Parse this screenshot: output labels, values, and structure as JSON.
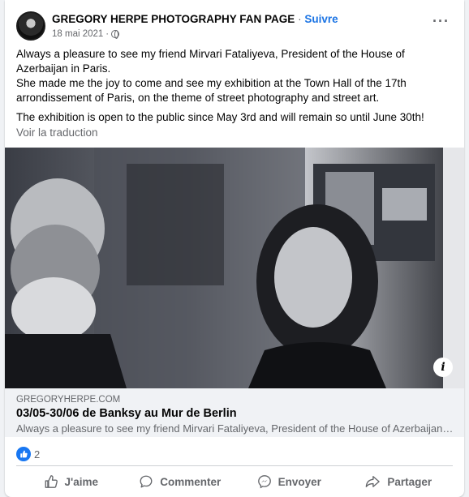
{
  "header": {
    "page_name": "GREGORY HERPE PHOTOGRAPHY FAN PAGE",
    "separator": " · ",
    "follow_label": "Suivre",
    "date": "18 mai 2021",
    "meta_separator": "·",
    "audience_icon": "globe-icon",
    "more_label": "···"
  },
  "post": {
    "paragraphs": [
      "Always a pleasure to see my friend Mirvari Fataliyeva, President of the House of Azerbaijan in Paris.\nShe made me the joy to come and see my exhibition at the Town Hall of the 17th arrondissement of Paris, on the theme of street photography and street art.",
      "The exhibition is open to the public since May 3rd and will remain so until June 30th!"
    ],
    "translate_label": "Voir la traduction"
  },
  "photo": {
    "info_label": "i"
  },
  "link_card": {
    "domain": "GREGORYHERPE.COM",
    "title": "03/05-30/06 de Banksy au Mur de Berlin",
    "description": "Always a pleasure to see my friend Mirvari Fataliyeva, President of the House of Azerbaijan in P..."
  },
  "reactions": {
    "icon": "like-icon",
    "count": "2"
  },
  "actions": [
    {
      "label": "J'aime",
      "icon": "thumbs-up-icon"
    },
    {
      "label": "Commenter",
      "icon": "comment-icon"
    },
    {
      "label": "Envoyer",
      "icon": "messenger-icon"
    },
    {
      "label": "Partager",
      "icon": "share-icon"
    }
  ],
  "colors": {
    "accent": "#1b74e4",
    "secondary_text": "#65676b",
    "background": "#f0f2f5"
  }
}
